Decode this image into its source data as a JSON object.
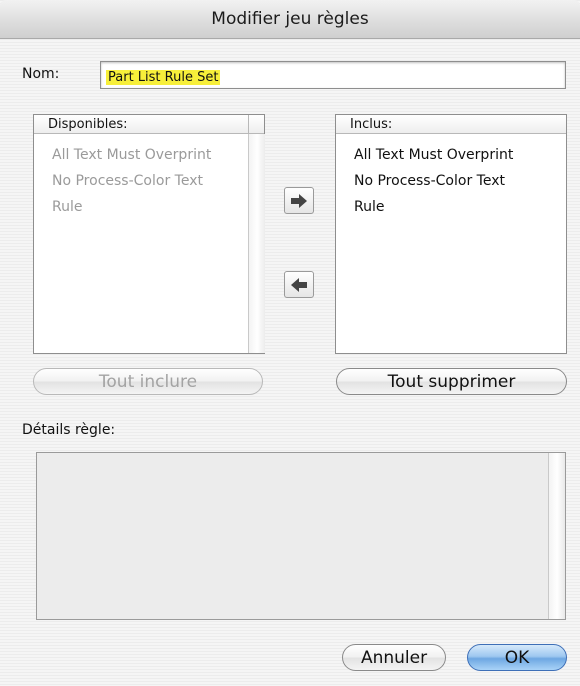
{
  "window": {
    "title": "Modifier jeu règles"
  },
  "name": {
    "label": "Nom:",
    "value": "Part List Rule Set"
  },
  "available": {
    "header": "Disponibles:",
    "items": [
      "All Text Must Overprint",
      "No Process-Color Text",
      "Rule"
    ],
    "state": "disabled"
  },
  "included": {
    "header": "Inclus:",
    "items": [
      "All Text Must Overprint",
      "No Process-Color Text",
      "Rule"
    ]
  },
  "transfer": {
    "add_icon": "right-arrow-icon",
    "remove_icon": "left-arrow-icon"
  },
  "buttons": {
    "include_all": "Tout inclure",
    "remove_all": "Tout supprimer",
    "cancel": "Annuler",
    "ok": "OK"
  },
  "details": {
    "label": "Détails règle:"
  },
  "colors": {
    "highlight": "#f7ef3a",
    "default_button": "#6ea7e2"
  }
}
